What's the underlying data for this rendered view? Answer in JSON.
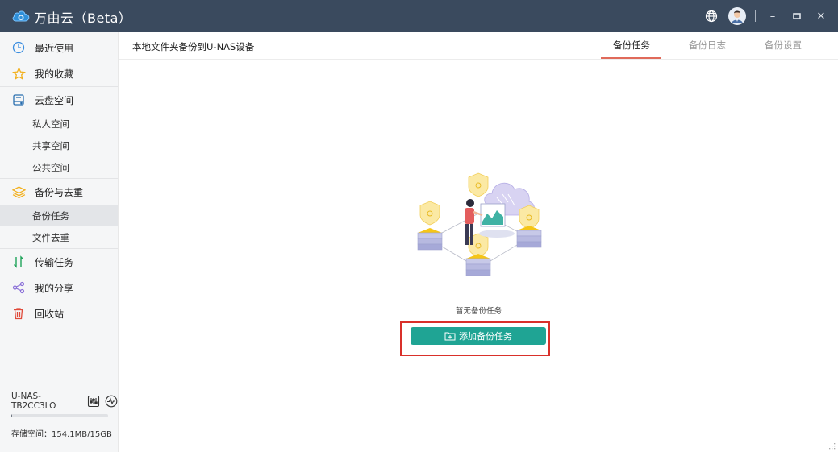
{
  "app": {
    "title": "万由云（Beta）"
  },
  "titlebar": {
    "icons": [
      "globe-icon",
      "avatar",
      "minimize-icon",
      "maximize-icon",
      "close-icon"
    ],
    "minimize_glyph": "–",
    "maximize_glyph": "□",
    "close_glyph": "✕"
  },
  "sidebar": {
    "items": [
      {
        "label": "最近使用",
        "icon": "clock-icon"
      },
      {
        "label": "我的收藏",
        "icon": "star-icon"
      },
      {
        "label": "云盘空间",
        "icon": "disk-icon",
        "children": [
          "私人空间",
          "共享空间",
          "公共空间"
        ]
      },
      {
        "label": "备份与去重",
        "icon": "layers-icon",
        "children": [
          "备份任务",
          "文件去重"
        ]
      },
      {
        "label": "传输任务",
        "icon": "transfer-icon"
      },
      {
        "label": "我的分享",
        "icon": "share-icon"
      },
      {
        "label": "回收站",
        "icon": "trash-icon"
      }
    ],
    "active": "备份任务"
  },
  "device": {
    "name": "U-NAS-TB2CC3LO",
    "storage_label": "存储空间：154.1MB/15GB",
    "storage_fraction": 0.01
  },
  "main": {
    "page_title": "本地文件夹备份到U-NAS设备",
    "tabs": [
      {
        "label": "备份任务",
        "active": true
      },
      {
        "label": "备份日志",
        "active": false
      },
      {
        "label": "备份设置",
        "active": false
      }
    ],
    "empty_text": "暂无备份任务",
    "add_button_label": "添加备份任务"
  },
  "colors": {
    "titlebar": "#3a4a5e",
    "accent": "#1fa494",
    "tab_underline": "#e06a5a",
    "highlight": "#d9302a"
  }
}
